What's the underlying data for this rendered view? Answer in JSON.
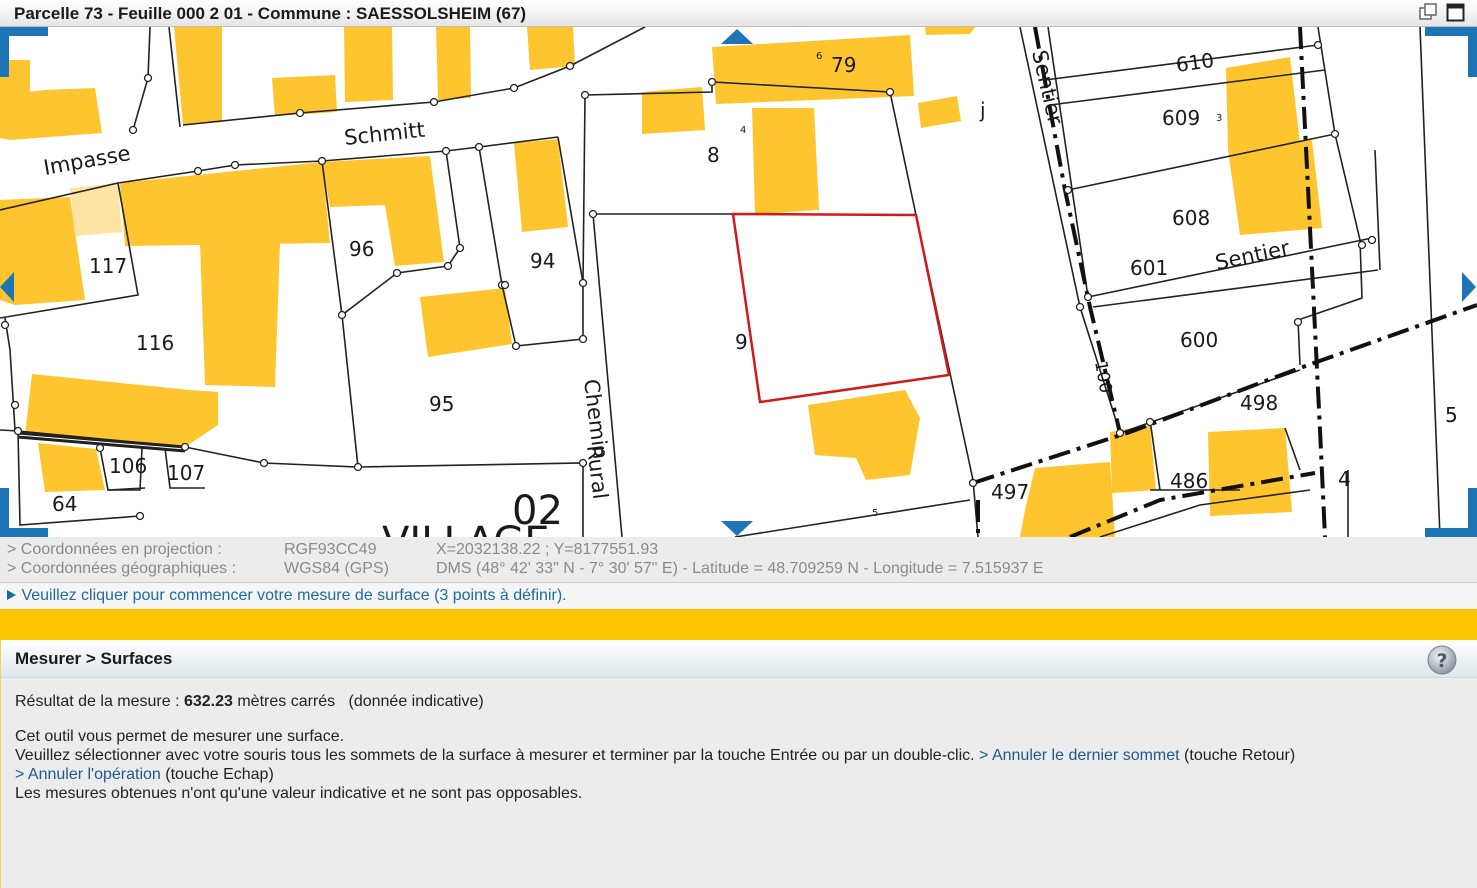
{
  "window": {
    "title": "Parcelle 73 - Feuille 000 2 01 - Commune : SAESSOLSHEIM (67)"
  },
  "map": {
    "labels": {
      "impasse": "Impasse",
      "schmitt": "Schmitt",
      "chemin": "Chemin",
      "rural": "Rural",
      "sentier_left": "Sentier",
      "sentier_right": "Sentier",
      "village": "VILLAGE",
      "section": "02",
      "road_code": "100"
    },
    "parcels": [
      "79",
      "8",
      "j",
      "610",
      "609",
      "608",
      "601",
      "96",
      "94",
      "117",
      "116",
      "95",
      "9",
      "600",
      "498",
      "5",
      "497",
      "486",
      "4",
      "106",
      "107",
      "64"
    ],
    "small_numbers": [
      "6",
      "4",
      "3",
      "5"
    ],
    "colors": {
      "building": "#fec52e",
      "building_light": "#fde3a4",
      "selection": "#d11a1a",
      "nav_arrow": "#1d74b6"
    }
  },
  "coordinates": {
    "projection_label": "> Coordonnées en projection :",
    "projection_system": "RGF93CC49",
    "projection_value": "X=2032138.22 ; Y=8177551.93",
    "geo_label": "> Coordonnées géographiques :",
    "geo_system": "WGS84 (GPS)",
    "geo_value": "DMS (48° 42' 33\" N - 7° 30' 57\" E) - Latitude = 48.709259 N - Longitude = 7.515937 E"
  },
  "hint": {
    "icon": "play-triangle-icon",
    "text": "Veuillez cliquer pour commencer votre mesure de surface (3 points à définir)."
  },
  "panel": {
    "title": "Mesurer > Surfaces",
    "result_prefix": "Résultat de la mesure : ",
    "result_value": "632.23",
    "result_unit": " mètres carrés",
    "result_note": "(donnée indicative)",
    "line1": "Cet outil vous permet de mesurer une surface.",
    "line2": "Veuillez sélectionner avec votre souris tous les sommets de la surface à mesurer et terminer par la touche Entrée ou par un double-clic.",
    "undo_vertex_link": "> Annuler le dernier sommet",
    "undo_vertex_key": " (touche Retour)",
    "cancel_link": "> Annuler l'opération",
    "cancel_key": " (touche Echap)",
    "line4": "Les mesures obtenues n'ont qu'une valeur indicative et ne sont pas opposables."
  }
}
